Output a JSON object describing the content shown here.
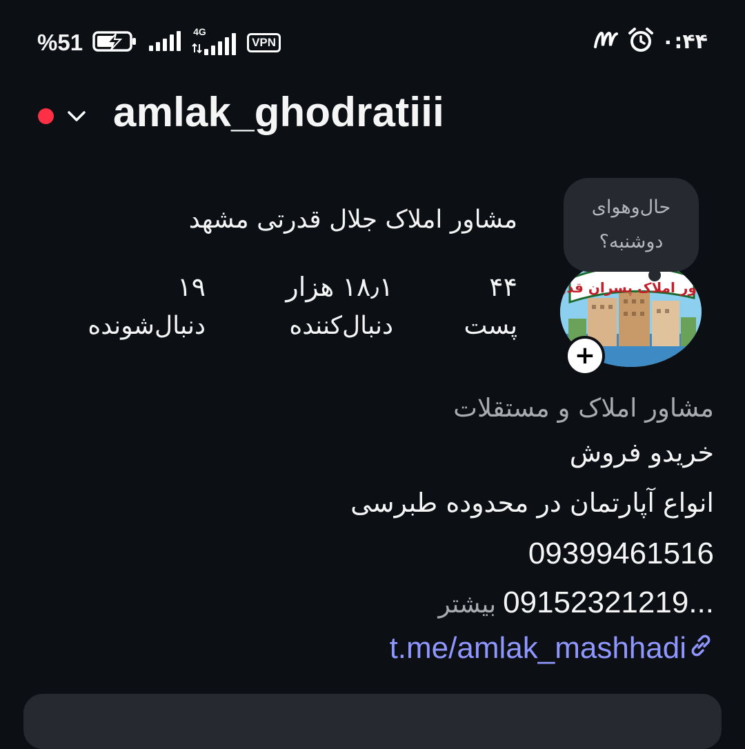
{
  "status_bar": {
    "battery_percent": "%51",
    "network_type": "4G",
    "vpn_label": "VPN",
    "time": "۰:۴۴",
    "icons": [
      "battery-charging-icon",
      "signal-bars-icon",
      "signal-bars-4g-icon",
      "vpn-icon",
      "alarm-icon",
      "m-app-icon"
    ]
  },
  "header": {
    "username": "amlak_ghodratiii",
    "live_dot_color": "#ff3045"
  },
  "profile": {
    "note": "حال‌و‌هوای دوشنبه؟",
    "full_name": "مشاور املاک جلال قدرتی مشهد",
    "avatar_text": "مشاور املاک پسران قدرتی",
    "stats": {
      "posts": {
        "value": "۴۴",
        "label": "پست"
      },
      "followers": {
        "value": "۱۸٫۱ هزار",
        "label": "دنبال‌کننده"
      },
      "following": {
        "value": "۱۹",
        "label": "دنبال‌شونده"
      }
    }
  },
  "bio": {
    "category": "مشاور املاک و مستقلات",
    "line1": "خریدو فروش",
    "line2": "انواع آپارتمان در محدوده طبرسی",
    "line3": "09399461516",
    "phone2": "09152321219...",
    "more_label": "بیشتر",
    "link": "t.me/amlak_mashhadi"
  },
  "colors": {
    "background": "#0c0f14",
    "text": "#f5f5f5",
    "muted": "#a8abb0",
    "link": "#8f97ff",
    "card": "#26292f"
  }
}
